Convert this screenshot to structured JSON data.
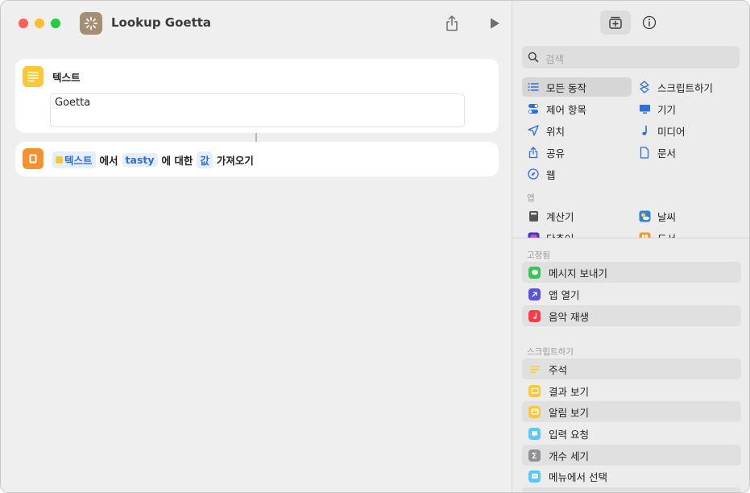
{
  "window": {
    "title": "Lookup Goetta"
  },
  "editor": {
    "text_action": {
      "title": "텍스트",
      "value": "Goetta"
    },
    "get_action": {
      "token_input": "텍스트",
      "word_from": "에서",
      "token_key": "tasty",
      "word_for": "에 대한",
      "token_value": "값",
      "word_get": "가져오기"
    }
  },
  "library": {
    "search_placeholder": "검색",
    "categories": [
      {
        "label": "모든 동작",
        "icon": "list-icon"
      },
      {
        "label": "스크립트하기",
        "icon": "scripting-icon"
      },
      {
        "label": "제어 항목",
        "icon": "toggle-icon"
      },
      {
        "label": "기기",
        "icon": "display-icon"
      },
      {
        "label": "위치",
        "icon": "location-arrow-icon"
      },
      {
        "label": "미디어",
        "icon": "music-note-icon"
      },
      {
        "label": "공유",
        "icon": "share-icon"
      },
      {
        "label": "문서",
        "icon": "document-icon"
      },
      {
        "label": "웹",
        "icon": "compass-icon"
      }
    ],
    "apps_section": "앱",
    "apps": [
      {
        "label": "계산기",
        "icon": "calculator-icon"
      },
      {
        "label": "날씨",
        "icon": "weather-icon"
      },
      {
        "label": "단축어",
        "icon": "shortcuts-icon"
      },
      {
        "label": "도서",
        "icon": "books-icon"
      }
    ],
    "pinned_section": "고정됨",
    "pinned": [
      {
        "label": "메시지 보내기",
        "icon": "messages-icon",
        "color": "#34c759"
      },
      {
        "label": "앱 열기",
        "icon": "open-app-icon",
        "color": "#5856d6"
      },
      {
        "label": "음악 재생",
        "icon": "music-icon",
        "color": "#fc3c44"
      }
    ],
    "scripting_section": "스크립트하기",
    "scripting": [
      {
        "label": "주석",
        "icon": "comment-icon",
        "color": "#fcc73a"
      },
      {
        "label": "결과 보기",
        "icon": "show-result-icon",
        "color": "#fcc73a"
      },
      {
        "label": "알림 보기",
        "icon": "show-alert-icon",
        "color": "#fcc73a"
      },
      {
        "label": "입력 요청",
        "icon": "ask-input-icon",
        "color": "#5ac8fa"
      },
      {
        "label": "개수 세기",
        "icon": "count-icon",
        "color": "#8e8e93"
      },
      {
        "label": "메뉴에서 선택",
        "icon": "choose-menu-icon",
        "color": "#5ac8fa"
      }
    ]
  }
}
